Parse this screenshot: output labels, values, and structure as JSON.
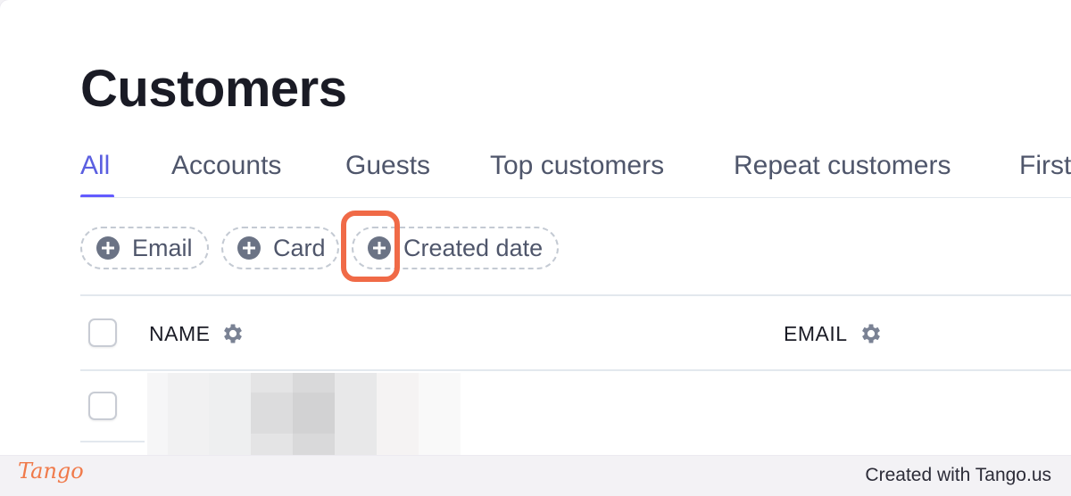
{
  "page": {
    "title": "Customers"
  },
  "tabs": [
    {
      "label": "All",
      "active": true
    },
    {
      "label": "Accounts",
      "active": false
    },
    {
      "label": "Guests",
      "active": false
    },
    {
      "label": "Top customers",
      "active": false
    },
    {
      "label": "Repeat customers",
      "active": false
    },
    {
      "label": "First",
      "active": false
    }
  ],
  "filters": [
    {
      "label": "Email",
      "icon": "plus-circle-icon"
    },
    {
      "label": "Card",
      "icon": "plus-circle-icon"
    },
    {
      "label": "Created date",
      "icon": "plus-circle-icon"
    }
  ],
  "table": {
    "columns": [
      {
        "label": "NAME",
        "icon": "gear-icon"
      },
      {
        "label": "EMAIL",
        "icon": "gear-icon"
      }
    ]
  },
  "footer": {
    "logo": "Tango",
    "credit": "Created with Tango.us"
  },
  "colors": {
    "accent": "#635bff",
    "highlight": "#f06a47",
    "brand": "#f07a4a"
  }
}
